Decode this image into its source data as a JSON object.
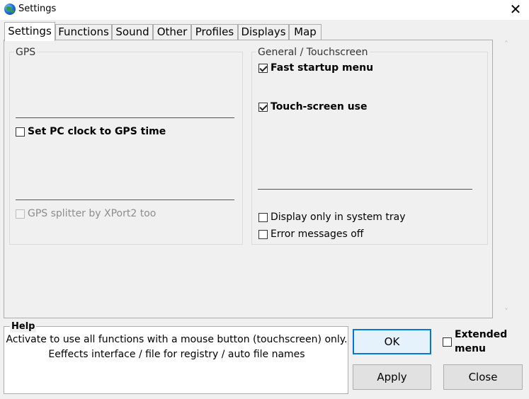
{
  "window": {
    "title": "Settings",
    "close_glyph": "✕",
    "icon": "globe-icon"
  },
  "tabs": [
    {
      "label": "Settings",
      "active": true
    },
    {
      "label": "Functions",
      "active": false
    },
    {
      "label": "Sound",
      "active": false
    },
    {
      "label": "Other",
      "active": false
    },
    {
      "label": "Profiles",
      "active": false
    },
    {
      "label": "Displays",
      "active": false
    },
    {
      "label": "Map",
      "active": false
    }
  ],
  "gps": {
    "title": "GPS",
    "set_pc_clock": {
      "label": "Set PC clock to GPS time",
      "checked": false
    },
    "gps_splitter": {
      "label": "GPS splitter by XPort2 too",
      "checked": false,
      "enabled": false
    }
  },
  "general": {
    "title": "General / Touchscreen",
    "fast_startup": {
      "label": "Fast startup menu",
      "checked": true
    },
    "touch_screen": {
      "label": "Touch-screen use",
      "checked": true
    },
    "system_tray": {
      "label": "Display only in system tray",
      "checked": false
    },
    "error_messages": {
      "label": "Error messages off",
      "checked": false
    }
  },
  "help": {
    "title": "Help",
    "line1": "Activate to use all functions with a mouse button (touchscreen) only.",
    "line2": "Eeffects interface / file for registry / auto file names"
  },
  "buttons": {
    "ok": "OK",
    "apply": "Apply",
    "close": "Close"
  },
  "extended_menu": {
    "line1": "Extended",
    "line2": "menu",
    "checked": false
  },
  "colors": {
    "accent": "#0078d7",
    "border": "#adadad",
    "background": "#f0f0f0"
  }
}
